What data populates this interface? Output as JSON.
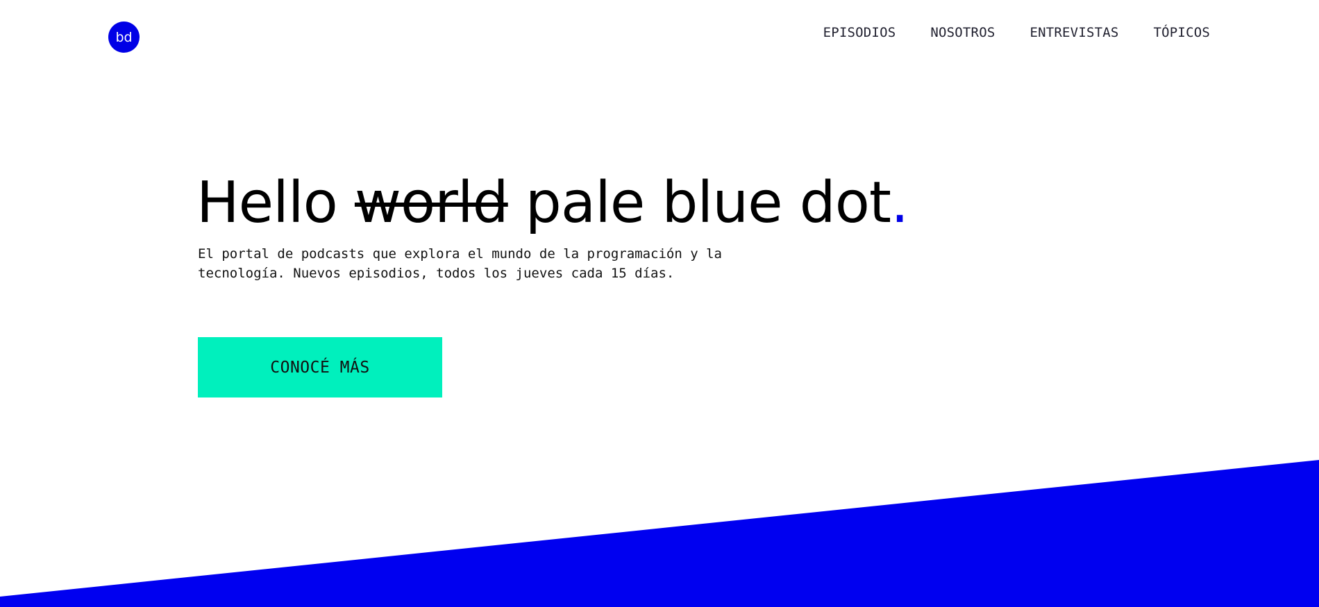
{
  "header": {
    "logo_text": "bd",
    "nav": [
      {
        "label": "EPISODIOS"
      },
      {
        "label": "NOSOTROS"
      },
      {
        "label": "ENTREVISTAS"
      },
      {
        "label": "TÓPICOS"
      }
    ]
  },
  "hero": {
    "title_part1": "Hello ",
    "title_strike": "world",
    "title_part2": " pale blue dot",
    "title_dot": ".",
    "subtitle": "El portal de podcasts que explora el mundo de la programación y la tecnología. Nuevos episodios, todos los jueves cada 15 días.",
    "cta_label": "CONOCÉ MÁS"
  },
  "colors": {
    "brand_blue": "#0000e6",
    "cta_green": "#00f0bd"
  }
}
